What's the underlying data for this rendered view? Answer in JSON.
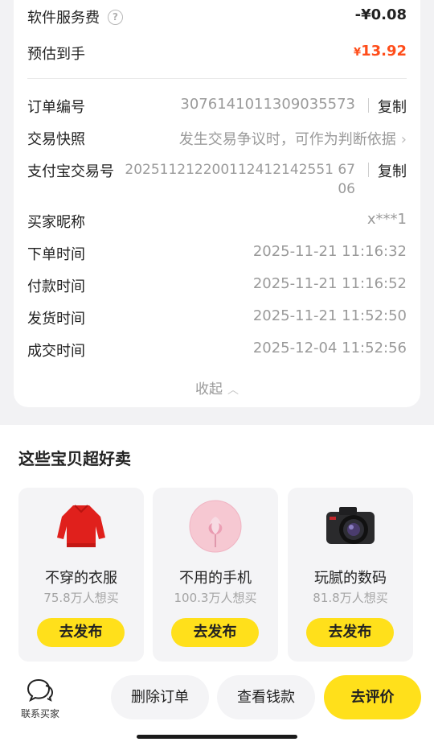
{
  "order_info": {
    "fee": {
      "label": "软件服务费",
      "value": "-¥0.08"
    },
    "estimate": {
      "label": "预估到手",
      "currency": "¥",
      "amount": "13.92"
    },
    "rows": [
      {
        "label": "订单编号",
        "value": "3076141011309035573",
        "action": "复制"
      },
      {
        "label": "交易快照",
        "value": "发生交易争议时，可作为判断依据"
      },
      {
        "label": "支付宝交易号",
        "value_line1": "202511212200112412142551 67",
        "value_line2": "06",
        "action": "复制"
      },
      {
        "label": "买家昵称",
        "value": "x***1"
      },
      {
        "label": "下单时间",
        "value": "2025-11-21 11:16:32"
      },
      {
        "label": "付款时间",
        "value": "2025-11-21 11:16:52"
      },
      {
        "label": "发货时间",
        "value": "2025-11-21 11:52:50"
      },
      {
        "label": "成交时间",
        "value": "2025-12-04 11:52:56"
      }
    ],
    "collapse_label": "收起"
  },
  "recommend": {
    "title": "这些宝贝超好卖",
    "items": [
      {
        "name": "不穿的衣服",
        "count": "75.8万人想买",
        "button": "去发布",
        "icon": "red-sweater-icon"
      },
      {
        "name": "不用的手机",
        "count": "100.3万人想买",
        "button": "去发布",
        "icon": "phone-flower-icon"
      },
      {
        "name": "玩腻的数码",
        "count": "81.8万人想买",
        "button": "去发布",
        "icon": "camera-icon"
      }
    ]
  },
  "bottom_bar": {
    "contact_label": "联系买家",
    "delete_label": "删除订单",
    "view_money_label": "查看钱款",
    "review_label": "去评价"
  },
  "colors": {
    "accent_yellow": "#ffe01b",
    "price_orange": "#ff4d1a"
  }
}
